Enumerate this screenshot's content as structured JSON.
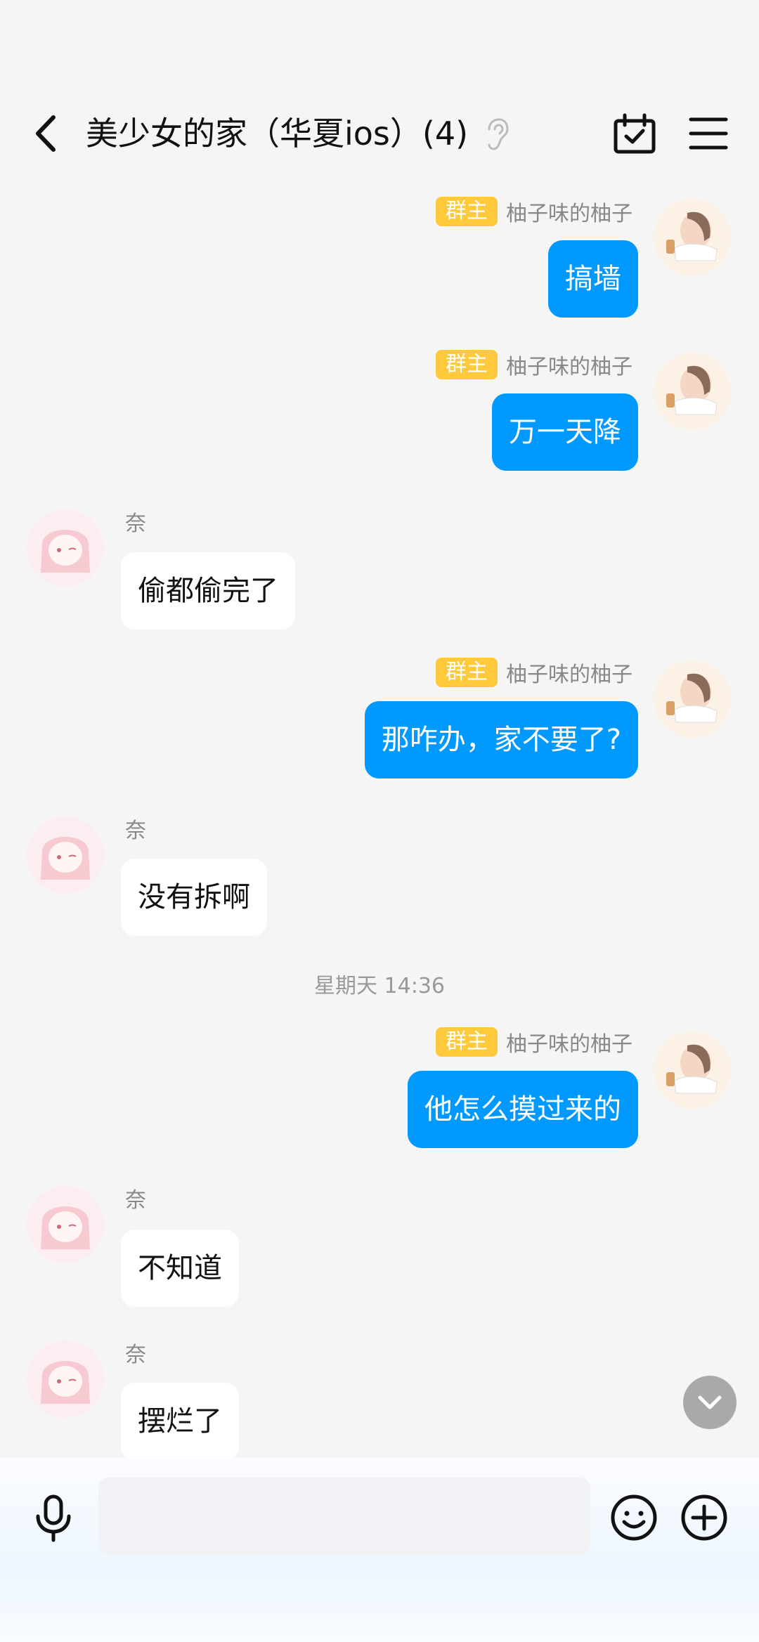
{
  "header": {
    "title": "美少女的家（华夏ios）(4)",
    "back_icon": "chevron-left-icon",
    "ear_icon": "ear-icon",
    "calendar_icon": "calendar-check-icon",
    "menu_icon": "menu-icon"
  },
  "messages": [
    {
      "type": "out",
      "badge": "群主",
      "sender": "柚子味的柚子",
      "text": "搞墙"
    },
    {
      "type": "out",
      "badge": "群主",
      "sender": "柚子味的柚子",
      "text": "万一天降"
    },
    {
      "type": "in",
      "sender": "奈",
      "text": "偷都偷完了"
    },
    {
      "type": "out",
      "badge": "群主",
      "sender": "柚子味的柚子",
      "text": "那咋办，家不要了?"
    },
    {
      "type": "in",
      "sender": "奈",
      "text": "没有拆啊"
    },
    {
      "type": "out",
      "badge": "群主",
      "sender": "柚子味的柚子",
      "text": "他怎么摸过来的"
    },
    {
      "type": "in",
      "sender": "奈",
      "text": "不知道"
    },
    {
      "type": "in",
      "sender": "奈",
      "text": "摆烂了"
    }
  ],
  "timestamp": "星期天 14:36",
  "input": {
    "value": "",
    "placeholder": ""
  },
  "colors": {
    "out_bubble": "#0099ff",
    "in_bubble": "#ffffff",
    "owner_badge": "#ffc93c",
    "background": "#f5f5f5"
  }
}
